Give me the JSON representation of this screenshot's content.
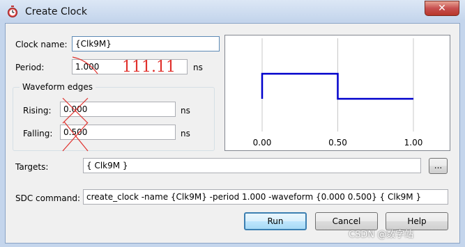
{
  "window": {
    "title": "Create Clock",
    "close_glyph": "✕"
  },
  "form": {
    "clock_name_label": "Clock name:",
    "clock_name_value": "{Clk9M}",
    "period_label": "Period:",
    "period_value": "1.000",
    "period_unit": "ns",
    "waveform_group_title": "Waveform edges",
    "rising_label": "Rising:",
    "rising_value": "0.000",
    "rising_unit": "ns",
    "falling_label": "Falling:",
    "falling_value": "0.500",
    "falling_unit": "ns",
    "targets_label": "Targets:",
    "targets_value": "{ Clk9M }",
    "browse_label": "...",
    "sdc_label": "SDC command:",
    "sdc_value": "create_clock -name {Clk9M} -period 1.000 -waveform {0.000 0.500} { Clk9M }"
  },
  "waveform": {
    "ticks": [
      "0.00",
      "0.50",
      "1.00"
    ],
    "rise_time": 0.0,
    "fall_time": 0.5,
    "end_time": 1.0,
    "line_color": "#0000cc"
  },
  "buttons": {
    "run": "Run",
    "cancel": "Cancel",
    "help": "Help"
  },
  "annotation": {
    "handwritten_value": "111.11",
    "color": "#e0302c"
  },
  "watermark": {
    "text": "CSDN @数字站"
  }
}
